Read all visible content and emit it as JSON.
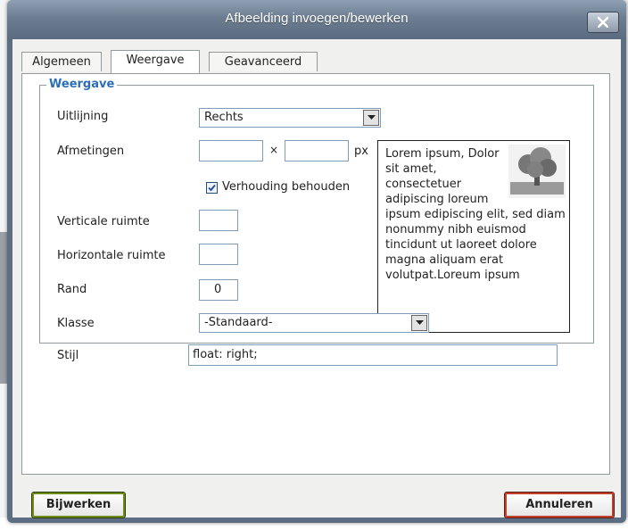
{
  "dialog": {
    "title": "Afbeelding invoegen/bewerken"
  },
  "tabs": [
    {
      "label": "Algemeen"
    },
    {
      "label": "Weergave"
    },
    {
      "label": "Geavanceerd"
    }
  ],
  "weergave": {
    "legend": "Weergave",
    "alignment": {
      "label": "Uitlijning",
      "value": "Rechts"
    },
    "dimensions": {
      "label": "Afmetingen",
      "width": "",
      "height": "",
      "separator": "×",
      "unit": "px"
    },
    "keep_ratio": {
      "label": "Verhouding behouden",
      "checked": true
    },
    "vspace": {
      "label": "Verticale ruimte",
      "value": ""
    },
    "hspace": {
      "label": "Horizontale ruimte",
      "value": ""
    },
    "border": {
      "label": "Rand",
      "value": "0"
    },
    "class": {
      "label": "Klasse",
      "value": "-Standaard-"
    },
    "style": {
      "label": "Stijl",
      "value": "float: right;"
    }
  },
  "preview": {
    "text": "Lorem ipsum, Dolor sit amet, consectetuer adipiscing loreum ipsum edipiscing elit, sed diam nonummy nibh euismod tincidunt ut laoreet dolore magna aliquam erat volutpat.Loreum ipsum"
  },
  "buttons": {
    "update": "Bijwerken",
    "cancel": "Annuleren"
  }
}
